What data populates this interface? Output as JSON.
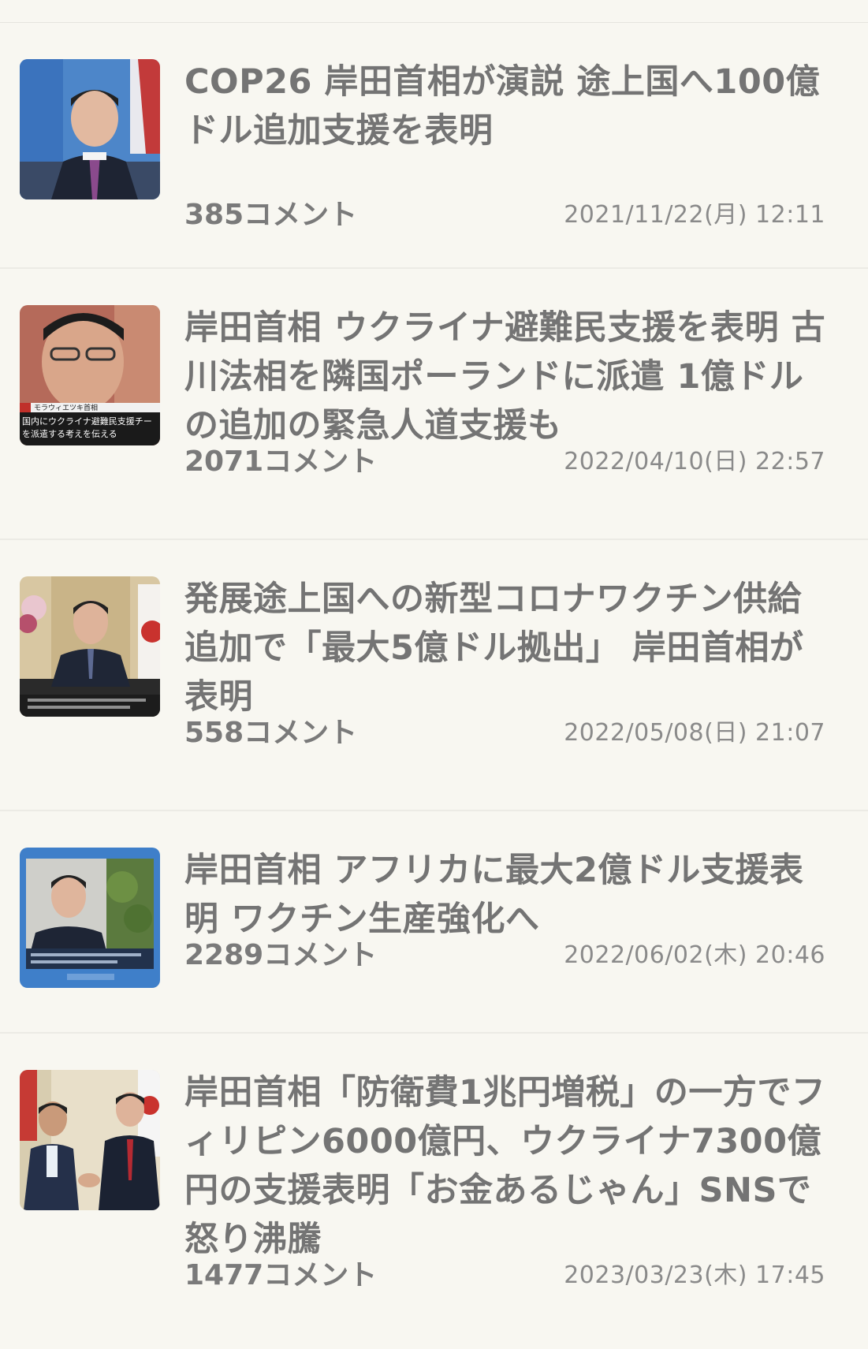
{
  "articles": [
    {
      "title": "COP26 岸田首相が演説 途上国へ100億ドル追加支援を表明",
      "comments": "385コメント",
      "date": "2021/11/22(月) 12:11",
      "thumb_icon": "kishida-speech-thumbnail"
    },
    {
      "title": "岸田首相 ウクライナ避難民支援を表明 古川法相を隣国ポーランドに派遣 1億ドルの追加の緊急人道支援も",
      "comments": "2071コメント",
      "date": "2022/04/10(日) 22:57",
      "thumb_icon": "kishida-closeup-thumbnail",
      "thumb_caption_top": "モラウィエツキ首相",
      "thumb_caption_1": "国内にウクライナ避難民支援チー",
      "thumb_caption_2": "を派遣する考えを伝える"
    },
    {
      "title": "発展途上国への新型コロナワクチン供給追加で「最大5億ドル拠出」 岸田首相が表明",
      "comments": "558コメント",
      "date": "2022/05/08(日) 21:07",
      "thumb_icon": "kishida-video-message-thumbnail"
    },
    {
      "title": "岸田首相 アフリカに最大2億ドル支援表明 ワクチン生産強化へ",
      "comments": "2289コメント",
      "date": "2022/06/02(木) 20:46",
      "thumb_icon": "kishida-online-meeting-thumbnail"
    },
    {
      "title": "岸田首相「防衛費1兆円増税」の一方でフィリピン6000億円、ウクライナ7300億円の支援表明「お金あるじゃん」SNSで怒り沸騰",
      "comments": "1477コメント",
      "date": "2023/03/23(木) 17:45",
      "thumb_icon": "kishida-handshake-thumbnail"
    }
  ]
}
